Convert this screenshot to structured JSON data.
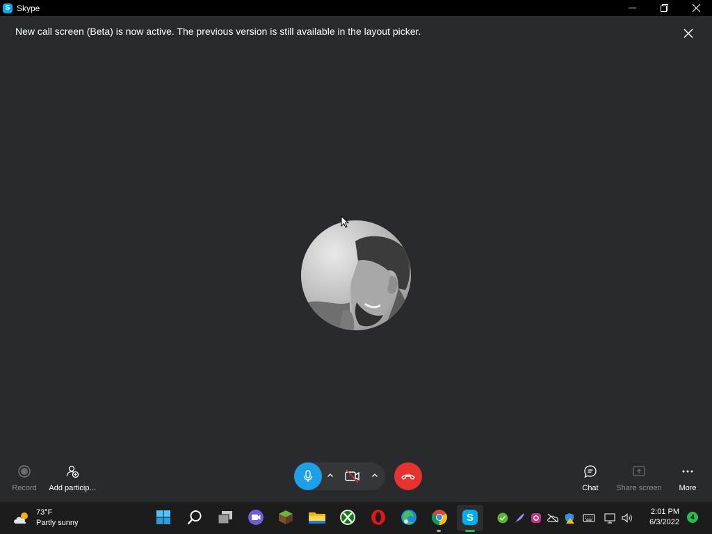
{
  "window": {
    "title": "Skype",
    "logo_letter": "S"
  },
  "banner": {
    "message": "New call screen (Beta) is now active. The previous version is still available in the layout picker."
  },
  "controls": {
    "record_label": "Record",
    "add_participants_label": "Add particip...",
    "chat_label": "Chat",
    "share_screen_label": "Share screen",
    "more_label": "More"
  },
  "taskbar": {
    "weather_temp": "73°F",
    "weather_desc": "Partly sunny",
    "skype_letter": "S",
    "time": "2:01 PM",
    "date": "6/3/2022",
    "notification_count": "4"
  },
  "colors": {
    "mic_active": "#1f9fe6",
    "end_call": "#e8322f",
    "call_bg": "#292a2e",
    "skype_brand": "#00aff0"
  },
  "icons": [
    "skype-logo-icon",
    "minimize-icon",
    "restore-icon",
    "close-icon",
    "record-icon",
    "add-person-icon",
    "microphone-icon",
    "chevron-up-icon",
    "camera-off-icon",
    "end-call-icon",
    "chat-icon",
    "share-screen-icon",
    "more-icon",
    "weather-icon",
    "windows-start-icon",
    "search-icon",
    "task-view-icon",
    "teams-icon",
    "minecraft-icon",
    "file-explorer-icon",
    "xbox-icon",
    "opera-icon",
    "edge-icon",
    "chrome-icon",
    "skype-icon",
    "shield-check-icon",
    "feather-icon",
    "instagram-icon",
    "onedrive-icon",
    "defender-warning-icon",
    "keyboard-icon",
    "network-icon",
    "volume-icon"
  ]
}
